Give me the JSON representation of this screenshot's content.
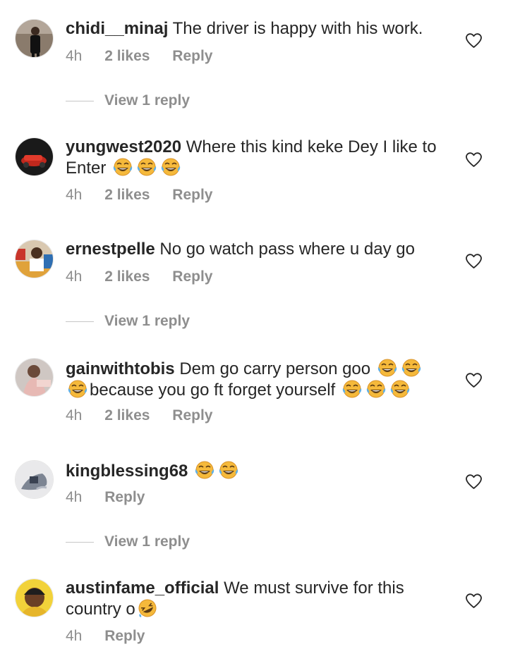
{
  "comments": [
    {
      "username": "chidi__minaj",
      "text": "The driver is happy with his work.",
      "time": "4h",
      "likes": "2 likes",
      "reply": "Reply",
      "view_replies": "View 1 reply"
    },
    {
      "username": "yungwest2020",
      "text": "Where this kind keke Dey I like to Enter",
      "time": "4h",
      "likes": "2 likes",
      "reply": "Reply"
    },
    {
      "username": "ernestpelle",
      "text": "No go watch pass where u day go",
      "time": "4h",
      "likes": "2 likes",
      "reply": "Reply",
      "view_replies": "View 1 reply"
    },
    {
      "username": "gainwithtobis",
      "text_a": "Dem go carry person goo",
      "text_b": "because you go ft forget yourself",
      "time": "4h",
      "likes": "2 likes",
      "reply": "Reply"
    },
    {
      "username": "kingblessing68",
      "time": "4h",
      "reply": "Reply",
      "view_replies": "View 1 reply"
    },
    {
      "username": "austinfame_official",
      "text": "We must survive for this country o",
      "time": "4h",
      "reply": "Reply"
    }
  ],
  "icons": {
    "like": "heart-outline-icon",
    "laugh": "face-with-tears-of-joy-emoji",
    "rofl": "rolling-on-floor-laughing-emoji"
  },
  "colors": {
    "text": "#262626",
    "meta": "#8e8e8e",
    "emoji": "#f5b93b"
  }
}
